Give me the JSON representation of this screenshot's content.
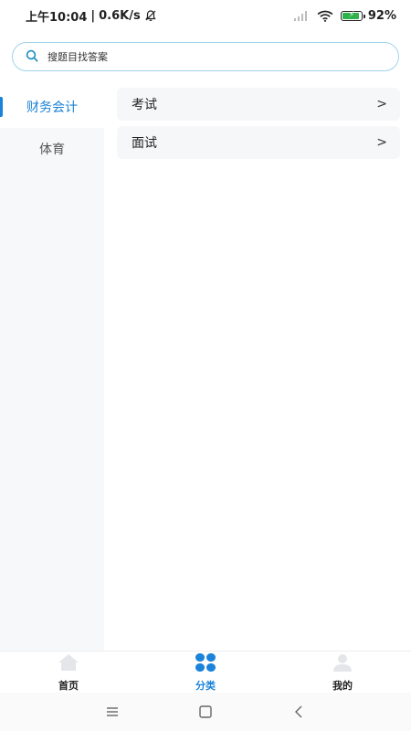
{
  "status_bar": {
    "time": "上午10:04",
    "separator": "|",
    "speed": "0.6K/s",
    "battery": "92%",
    "battery_level": 0.92,
    "battery_color": "#2fb24b"
  },
  "search": {
    "placeholder": "搜题目找答案",
    "border_color": "#9fd4e9"
  },
  "sidebar": {
    "items": [
      {
        "label": "财务会计",
        "active": true
      },
      {
        "label": "体育",
        "active": false
      }
    ],
    "accent": "#1b83d9"
  },
  "content": {
    "rows": [
      {
        "label": "考试",
        "chevron": ">"
      },
      {
        "label": "面试",
        "chevron": ">"
      }
    ]
  },
  "tabbar": {
    "tabs": [
      {
        "label": "首页",
        "icon": "home-icon",
        "active": false
      },
      {
        "label": "分类",
        "icon": "category-grid-icon",
        "active": true
      },
      {
        "label": "我的",
        "icon": "person-icon",
        "active": false
      }
    ]
  },
  "system_nav": {
    "buttons": [
      "menu-icon",
      "home-square-icon",
      "back-icon"
    ]
  }
}
